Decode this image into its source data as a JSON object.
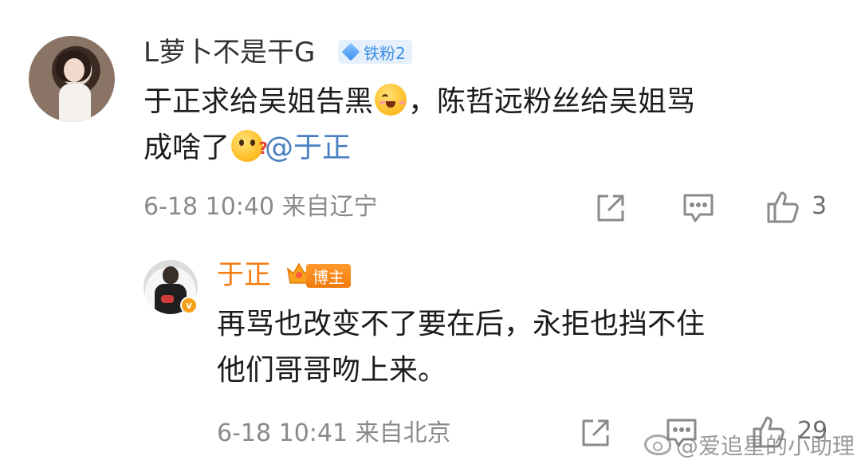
{
  "comments": [
    {
      "username": "L萝卜不是干G",
      "badge": "铁粉2",
      "text_line1_a": "于正求给吴姐告黑",
      "emoji1": "smiling-face-emoji",
      "text_line1_b": "，陈哲远粉丝给吴姐骂",
      "text_line2_a": "成啥了",
      "emoji2": "thinking-face-emoji",
      "mention": "@于正",
      "time": "6-18 10:40",
      "location": "来自辽宁",
      "like_count": "3"
    },
    {
      "username": "于正",
      "badge": "博主",
      "verified_mark": "v",
      "text_line1": "再骂也改变不了要在后，永拒也挡不住",
      "text_line2": "他们哥哥吻上来。",
      "time": "6-18 10:41",
      "location": "来自北京",
      "like_count": "29"
    }
  ],
  "watermark": "@爱追星的小助理",
  "colors": {
    "reply_username": "#f77b0e",
    "mention": "#4a7fc1",
    "meta": "#8a8a8a",
    "fan_badge_bg": "#e6f0fc",
    "fan_badge_text": "#3a8ce6",
    "host_badge": "#f27a0b"
  }
}
